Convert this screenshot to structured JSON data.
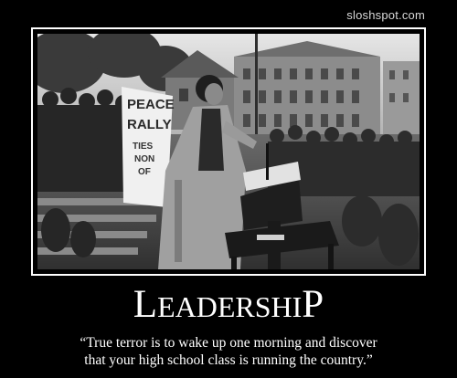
{
  "watermark": "sloshspot.com",
  "photo": {
    "sign": {
      "line1": "PEACE",
      "line2": "RALLY",
      "line3": "TIES",
      "line4": "NON",
      "line5": "OF"
    }
  },
  "title": {
    "first_letter": "L",
    "middle": "EADERSHI",
    "last_letter": "P"
  },
  "quote": {
    "line1": "“True terror is to wake up one morning and discover",
    "line2": "that your high school class is running the country.”"
  },
  "colors": {
    "background": "#000000",
    "frame_border": "#ffffff",
    "text": "#ffffff"
  }
}
